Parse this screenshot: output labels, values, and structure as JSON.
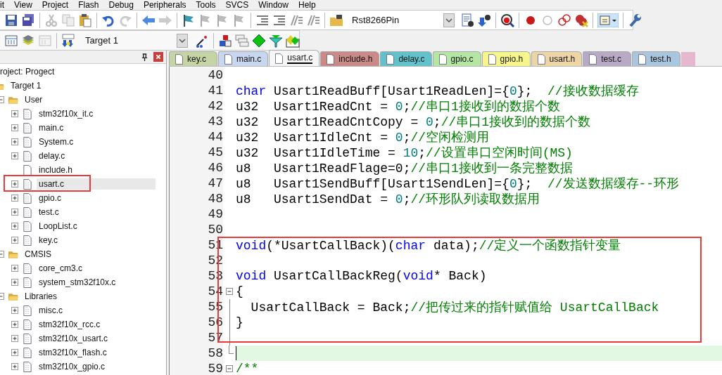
{
  "menu": [
    "it",
    "View",
    "Project",
    "Flash",
    "Debug",
    "Peripherals",
    "Tools",
    "SVCS",
    "Window",
    "Help"
  ],
  "toolbar": {
    "find_combo": {
      "value": "Rst8266Pin"
    },
    "target_combo": {
      "value": "Target 1"
    }
  },
  "project_panel": {
    "title": "roject: Progect",
    "tree": [
      {
        "label": "Target 1",
        "kind": "folder",
        "selected": false,
        "marked": false,
        "children": [
          {
            "label": "User",
            "kind": "folder",
            "expanded": true,
            "selected": false,
            "marked": false,
            "children": [
              {
                "label": "stm32f10x_it.c",
                "kind": "file",
                "selected": false,
                "marked": false
              },
              {
                "label": "main.c",
                "kind": "file",
                "selected": false,
                "marked": false
              },
              {
                "label": "System.c",
                "kind": "file",
                "selected": false,
                "marked": false
              },
              {
                "label": "delay.c",
                "kind": "file",
                "selected": false,
                "marked": false
              },
              {
                "label": "include.h",
                "kind": "header",
                "selected": false,
                "marked": false
              },
              {
                "label": "usart.c",
                "kind": "file",
                "selected": true,
                "marked": true
              },
              {
                "label": "gpio.c",
                "kind": "file",
                "selected": false,
                "marked": false
              },
              {
                "label": "test.c",
                "kind": "file",
                "selected": false,
                "marked": false
              },
              {
                "label": "LoopList.c",
                "kind": "file",
                "selected": false,
                "marked": false
              },
              {
                "label": "key.c",
                "kind": "file",
                "selected": false,
                "marked": false
              }
            ]
          },
          {
            "label": "CMSIS",
            "kind": "folder",
            "expanded": true,
            "selected": false,
            "marked": false,
            "children": [
              {
                "label": "core_cm3.c",
                "kind": "file",
                "selected": false,
                "marked": false
              },
              {
                "label": "system_stm32f10x.c",
                "kind": "file",
                "selected": false,
                "marked": false
              }
            ]
          },
          {
            "label": "Libraries",
            "kind": "folder",
            "expanded": true,
            "selected": false,
            "marked": false,
            "children": [
              {
                "label": "misc.c",
                "kind": "file",
                "selected": false,
                "marked": false
              },
              {
                "label": "stm32f10x_rcc.c",
                "kind": "file",
                "selected": false,
                "marked": false
              },
              {
                "label": "stm32f10x_usart.c",
                "kind": "file",
                "selected": false,
                "marked": false
              },
              {
                "label": "stm32f10x_flash.c",
                "kind": "file",
                "selected": false,
                "marked": false
              },
              {
                "label": "stm32f10x_gpio.c",
                "kind": "file",
                "selected": false,
                "marked": false
              }
            ]
          }
        ]
      }
    ]
  },
  "tabs": [
    {
      "label": "key.c",
      "selected": false,
      "color": "#c5d4a4"
    },
    {
      "label": "main.c",
      "selected": false,
      "color": "#c8d6f0"
    },
    {
      "label": "usart.c",
      "selected": true,
      "color": "#f6f6f6"
    },
    {
      "label": "include.h",
      "selected": false,
      "color": "#c98a88"
    },
    {
      "label": "delay.c",
      "selected": false,
      "color": "#62c2cc"
    },
    {
      "label": "gpio.c",
      "selected": false,
      "color": "#b5e6a4"
    },
    {
      "label": "gpio.h",
      "selected": false,
      "color": "#f6f68c"
    },
    {
      "label": "usart.h",
      "selected": false,
      "color": "#ecd6a8"
    },
    {
      "label": "test.c",
      "selected": false,
      "color": "#b8aac6"
    },
    {
      "label": "test.h",
      "selected": false,
      "color": "#aac6de"
    }
  ],
  "editor": {
    "sections": [
      {
        "boxed": false,
        "lines": [
          {
            "number": "40"
          },
          {
            "number": "41",
            "tokens": [
              {
                "kind": "keyword",
                "text": "char"
              },
              {
                "kind": "plain",
                "text": " Usart1ReadBuff[Usart1ReadLen]={"
              },
              {
                "kind": "number",
                "text": "0"
              },
              {
                "kind": "plain",
                "text": "};  "
              },
              {
                "kind": "comment",
                "text": "//接收数据缓存"
              }
            ]
          },
          {
            "number": "42",
            "tokens": [
              {
                "kind": "plain",
                "text": "u32  Usart1ReadCnt = "
              },
              {
                "kind": "number",
                "text": "0"
              },
              {
                "kind": "plain",
                "text": ";"
              },
              {
                "kind": "comment",
                "text": "//串口1接收到的数据个数"
              }
            ]
          },
          {
            "number": "43",
            "tokens": [
              {
                "kind": "plain",
                "text": "u32  Usart1ReadCntCopy = "
              },
              {
                "kind": "number",
                "text": "0"
              },
              {
                "kind": "plain",
                "text": ";"
              },
              {
                "kind": "comment",
                "text": "//串口1接收到的数据个数"
              }
            ]
          },
          {
            "number": "44",
            "tokens": [
              {
                "kind": "plain",
                "text": "u32  Usart1IdleCnt = "
              },
              {
                "kind": "number",
                "text": "0"
              },
              {
                "kind": "plain",
                "text": ";"
              },
              {
                "kind": "comment",
                "text": "//空闲检测用"
              }
            ]
          },
          {
            "number": "45",
            "tokens": [
              {
                "kind": "plain",
                "text": "u32  Usart1IdleTime = "
              },
              {
                "kind": "number",
                "text": "10"
              },
              {
                "kind": "plain",
                "text": ";"
              },
              {
                "kind": "comment",
                "text": "//设置串口空闲时间(MS)"
              }
            ]
          },
          {
            "number": "46",
            "tokens": [
              {
                "kind": "plain",
                "text": "u8   Usart1ReadFlage=0;"
              },
              {
                "kind": "comment",
                "text": "//串口1接收到一条完整数据"
              }
            ]
          },
          {
            "number": "47",
            "tokens": [
              {
                "kind": "plain",
                "text": "u8   Usart1SendBuff[Usart1SendLen]={"
              },
              {
                "kind": "number",
                "text": "0"
              },
              {
                "kind": "plain",
                "text": "};  "
              },
              {
                "kind": "comment",
                "text": "//发送数据缓存--环形"
              }
            ]
          },
          {
            "number": "48",
            "tokens": [
              {
                "kind": "plain",
                "text": "u8   Usart1SendDat = "
              },
              {
                "kind": "number",
                "text": "0"
              },
              {
                "kind": "plain",
                "text": ";"
              },
              {
                "kind": "comment",
                "text": "//环形队列读取数据用"
              }
            ]
          },
          {
            "number": "49"
          },
          {
            "number": "50"
          }
        ]
      },
      {
        "boxed": true,
        "lines": [
          {
            "number": "51",
            "tokens": [
              {
                "kind": "keyword",
                "text": "void"
              },
              {
                "kind": "plain",
                "text": "(*UsartCallBack)("
              },
              {
                "kind": "keyword",
                "text": "char"
              },
              {
                "kind": "plain",
                "text": " data);"
              },
              {
                "kind": "comment",
                "text": "//定义一个函数指针变量"
              }
            ]
          },
          {
            "number": "52"
          },
          {
            "number": "53",
            "tokens": [
              {
                "kind": "keyword",
                "text": "void"
              },
              {
                "kind": "plain",
                "text": " UsartCallBackReg("
              },
              {
                "kind": "keyword",
                "text": "void"
              },
              {
                "kind": "plain",
                "text": "* Back)"
              }
            ]
          },
          {
            "number": "54",
            "kind": "fold-start",
            "tokens": [
              {
                "kind": "plain",
                "text": "{"
              }
            ]
          },
          {
            "number": "55",
            "kind": "fold-body",
            "tokens": [
              {
                "kind": "plain",
                "text": "  UsartCallBack = Back;"
              },
              {
                "kind": "comment",
                "text": "//把传过来的指针赋值给 UsartCallBack"
              }
            ]
          },
          {
            "number": "56",
            "kind": "fold-body",
            "tokens": [
              {
                "kind": "plain",
                "text": "}"
              }
            ]
          },
          {
            "number": "57",
            "kind": "fold-body"
          }
        ]
      },
      {
        "boxed": false,
        "lines": [
          {
            "number": "58",
            "kind": "fold-end",
            "current": true
          },
          {
            "number": "59",
            "kind": "fold-start",
            "tokens": [
              {
                "kind": "comment",
                "text": "/**"
              }
            ]
          }
        ]
      }
    ]
  }
}
